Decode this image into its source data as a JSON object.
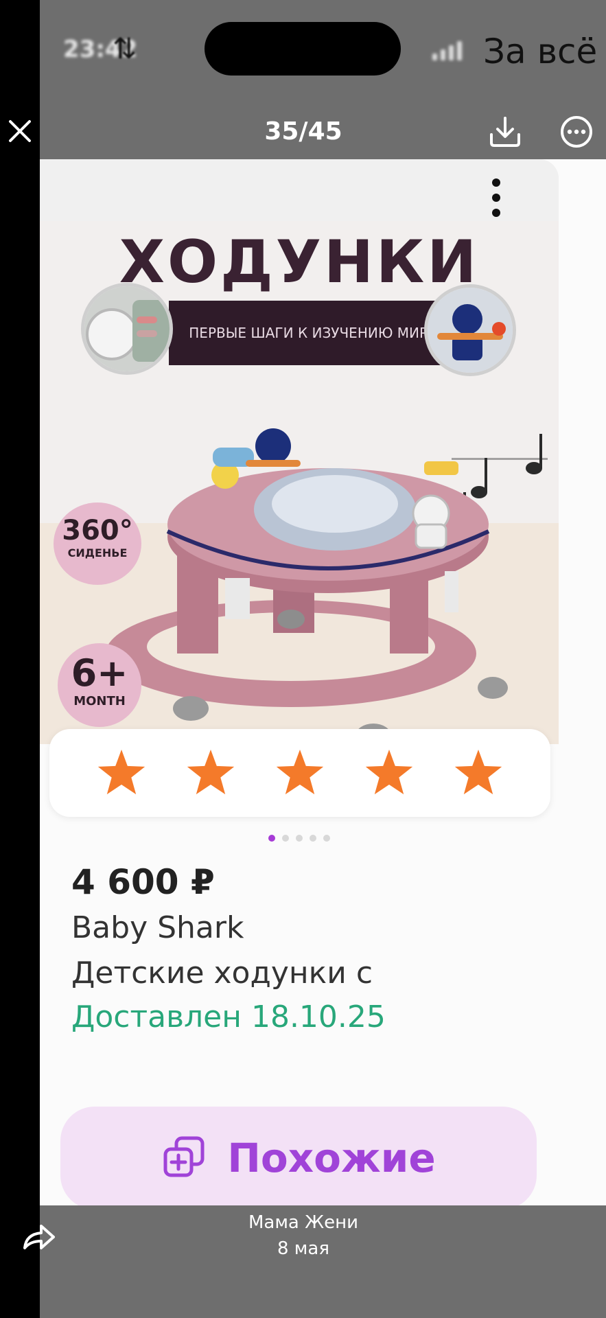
{
  "status_bar": {
    "time": "23:42",
    "overlay_text": "За всё"
  },
  "viewer": {
    "counter": "35/45"
  },
  "product": {
    "image": {
      "title": "ХОДУНКИ",
      "subtitle": "ПЕРВЫЕ ШАГИ К ИЗУЧЕНИЮ МИРА",
      "badge_360_value": "360°",
      "badge_360_label": "СИДЕНЬЕ",
      "badge_age_value": "6+",
      "badge_age_label": "MONTH"
    },
    "rating_stars": 5,
    "carousel": {
      "total": 5,
      "active": 1
    },
    "price": "4 600 ₽",
    "brand": "Baby Shark",
    "name": "Детские ходунки с",
    "delivery_status": "Доставлен 18.10.25",
    "similar_button": "Похожие"
  },
  "message": {
    "sender": "Мама Жени",
    "date": "8 мая"
  },
  "colors": {
    "star": "#f47a2a",
    "accent_purple": "#a043d8",
    "delivered_green": "#28a77a",
    "chrome_gray": "#6e6e6e"
  }
}
